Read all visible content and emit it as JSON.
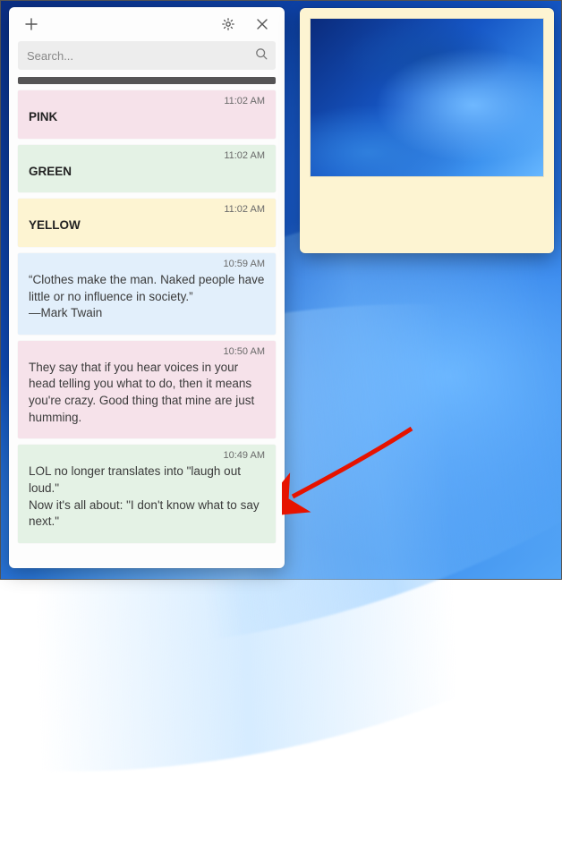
{
  "search": {
    "placeholder": "Search..."
  },
  "notes": [
    {
      "time": "",
      "body": "",
      "color": "charcoal",
      "bold": false,
      "thin": true
    },
    {
      "time": "11:02 AM",
      "body": "PINK",
      "color": "pink",
      "bold": true
    },
    {
      "time": "11:02 AM",
      "body": "GREEN",
      "color": "green",
      "bold": true
    },
    {
      "time": "11:02 AM",
      "body": "YELLOW",
      "color": "yellow",
      "bold": true
    },
    {
      "time": "10:59 AM",
      "body": "“Clothes make the man. Naked people have little or no influence in society.”\n―Mark Twain",
      "color": "blue",
      "bold": false
    },
    {
      "time": "10:50 AM",
      "body": "They say that if you hear voices in your head telling you what to do, then it means you're crazy. Good thing that mine are just humming.",
      "color": "pink",
      "bold": false
    },
    {
      "time": "10:49 AM",
      "body": "LOL no longer translates into \"laugh out loud.\"\nNow it's all about: \"I don't know what to say next.\"",
      "color": "green",
      "bold": false
    }
  ],
  "open_note": {
    "has_image": true,
    "color": "yellow"
  },
  "icons": {
    "plus": "plus-icon",
    "gear": "gear-icon",
    "close": "close-icon",
    "search": "search-icon"
  }
}
